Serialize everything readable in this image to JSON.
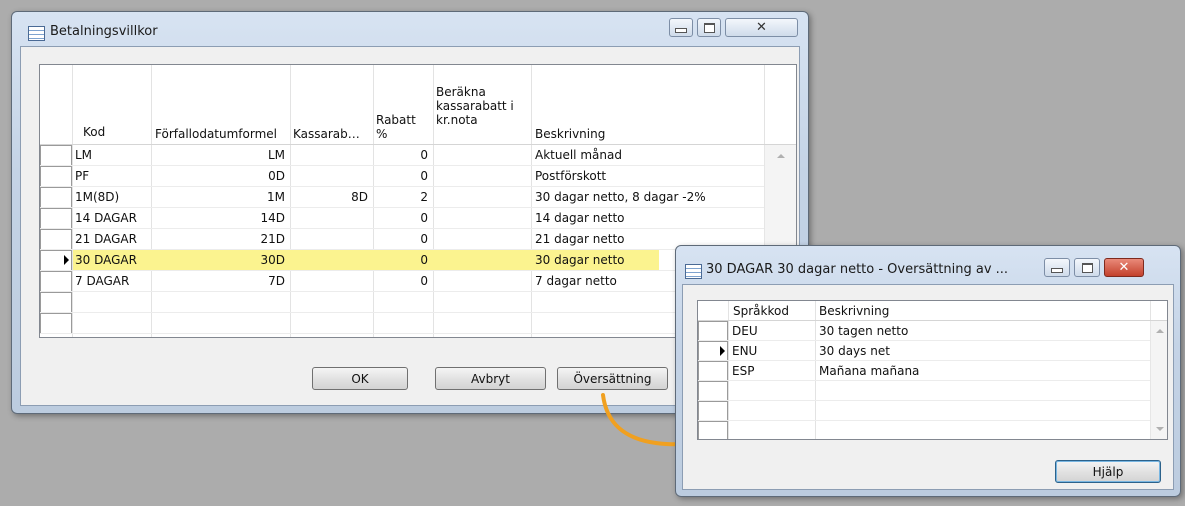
{
  "main_window": {
    "title": "Betalningsvillkor",
    "columns": {
      "kod": "Kod",
      "formel": "Förfallodatumformel",
      "kassarab": "Kassarab…",
      "rabatt": "Rabatt\n%",
      "berakna": "Beräkna\nkassarabatt i\nkr.nota",
      "beskrivning": "Beskrivning"
    },
    "rows": [
      {
        "kod": "LM",
        "formel": "LM",
        "kassarab": "",
        "rabatt": "0",
        "berakna": "",
        "beskrivning": "Aktuell månad"
      },
      {
        "kod": "PF",
        "formel": "0D",
        "kassarab": "",
        "rabatt": "0",
        "berakna": "",
        "beskrivning": "Postförskott"
      },
      {
        "kod": "1M(8D)",
        "formel": "1M",
        "kassarab": "8D",
        "rabatt": "2",
        "berakna": "",
        "beskrivning": "30 dagar netto, 8 dagar -2%"
      },
      {
        "kod": "14 DAGAR",
        "formel": "14D",
        "kassarab": "",
        "rabatt": "0",
        "berakna": "",
        "beskrivning": "14 dagar netto"
      },
      {
        "kod": "21 DAGAR",
        "formel": "21D",
        "kassarab": "",
        "rabatt": "0",
        "berakna": "",
        "beskrivning": "21 dagar netto"
      },
      {
        "kod": "30 DAGAR",
        "formel": "30D",
        "kassarab": "",
        "rabatt": "0",
        "berakna": "",
        "beskrivning": "30 dagar netto"
      },
      {
        "kod": "7 DAGAR",
        "formel": "7D",
        "kassarab": "",
        "rabatt": "0",
        "berakna": "",
        "beskrivning": "7 dagar netto"
      }
    ],
    "selected_row_index": 5,
    "buttons": {
      "ok": "OK",
      "avbryt": "Avbryt",
      "oversattning": "Översättning"
    }
  },
  "translation_window": {
    "title": "30 DAGAR 30 dagar netto - Översättning av ...",
    "columns": {
      "sprakkod": "Språkkod",
      "beskrivning": "Beskrivning"
    },
    "rows": [
      {
        "sprakkod": "DEU",
        "beskrivning": "30 tagen netto"
      },
      {
        "sprakkod": "ENU",
        "beskrivning": "30 days net"
      },
      {
        "sprakkod": "ESP",
        "beskrivning": "Mañana mañana"
      }
    ],
    "selected_row_index": 1,
    "buttons": {
      "hjalp": "Hjälp"
    }
  },
  "colors": {
    "highlight_row": "#fbf38f",
    "arrow": "#f0a020",
    "close_button": "#c3412c"
  }
}
